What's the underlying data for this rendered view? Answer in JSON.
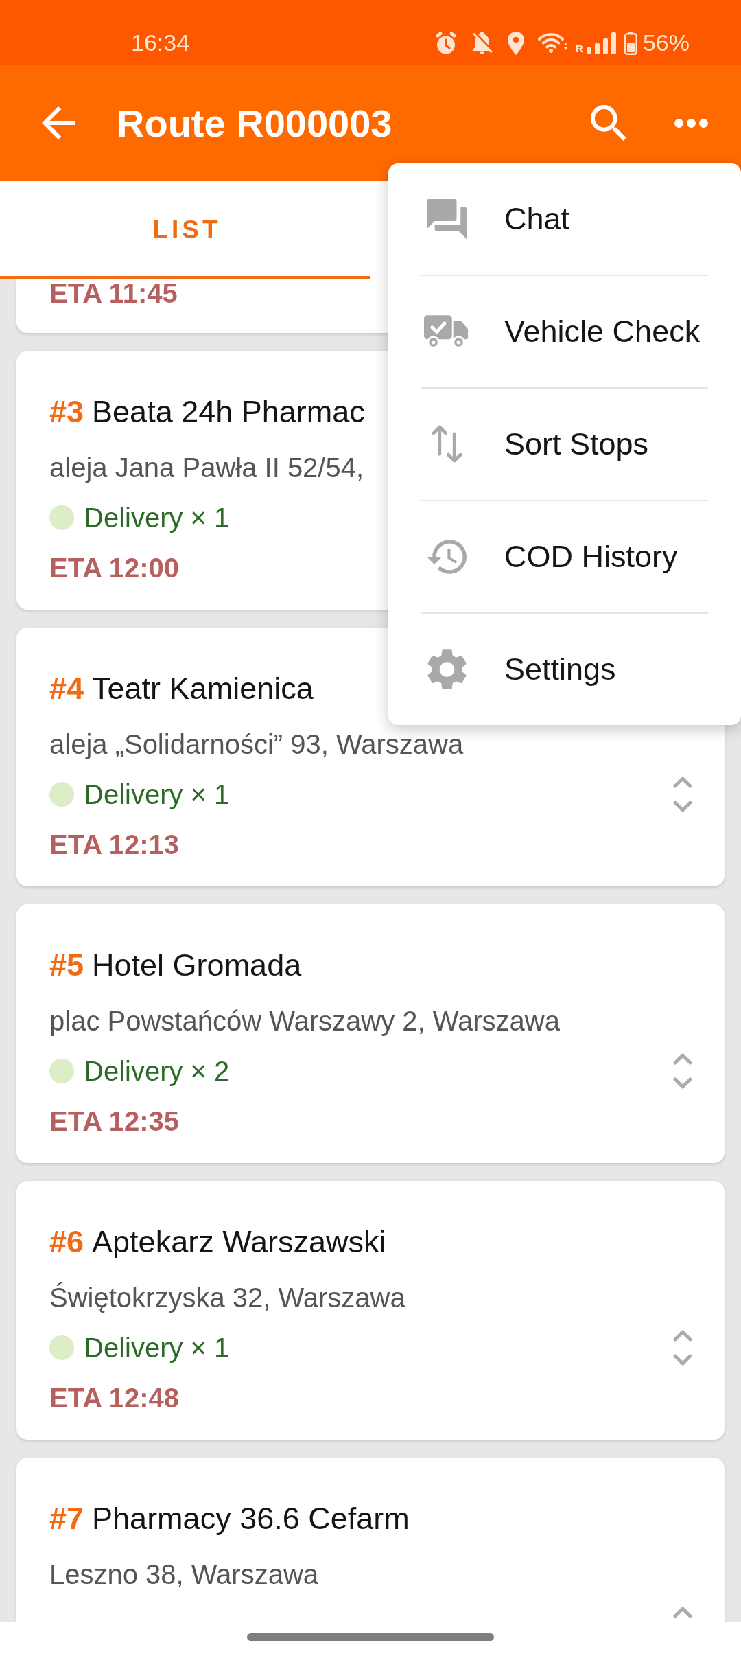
{
  "status_bar": {
    "time": "16:34",
    "roaming": "R",
    "battery": "56%"
  },
  "app_bar": {
    "title": "Route R000003"
  },
  "tabs": [
    {
      "label": "LIST",
      "selected": true
    }
  ],
  "stops": [
    {
      "eta": "ETA 11:45",
      "handle": false
    },
    {
      "number": "#3",
      "name": "Beata 24h Pharmac",
      "address": "aleja Jana Pawła II 52/54,",
      "task": "Delivery × 1",
      "color": "#dcedc8",
      "eta": "ETA 12:00",
      "handle": false
    },
    {
      "number": "#4",
      "name": "Teatr Kamienica",
      "address": "aleja „Solidarności” 93, Warszawa",
      "task": "Delivery × 1",
      "color": "#dcedc8",
      "eta": "ETA 12:13",
      "handle": true
    },
    {
      "number": "#5",
      "name": "Hotel Gromada",
      "address": "plac Powstańców Warszawy 2, Warszawa",
      "task": "Delivery × 2",
      "color": "#dcedc8",
      "eta": "ETA 12:35",
      "handle": true
    },
    {
      "number": "#6",
      "name": "Aptekarz Warszawski",
      "address": "Świętokrzyska 32, Warszawa",
      "task": "Delivery × 1",
      "color": "#dcedc8",
      "eta": "ETA 12:48",
      "handle": true
    },
    {
      "number": "#7",
      "name": "Pharmacy 36.6 Cefarm",
      "address": "Leszno 38, Warszawa",
      "handle": true
    }
  ],
  "menu": {
    "items": [
      {
        "label": "Chat"
      },
      {
        "label": "Vehicle Check"
      },
      {
        "label": "Sort Stops"
      },
      {
        "label": "COD History"
      },
      {
        "label": "Settings"
      }
    ]
  }
}
